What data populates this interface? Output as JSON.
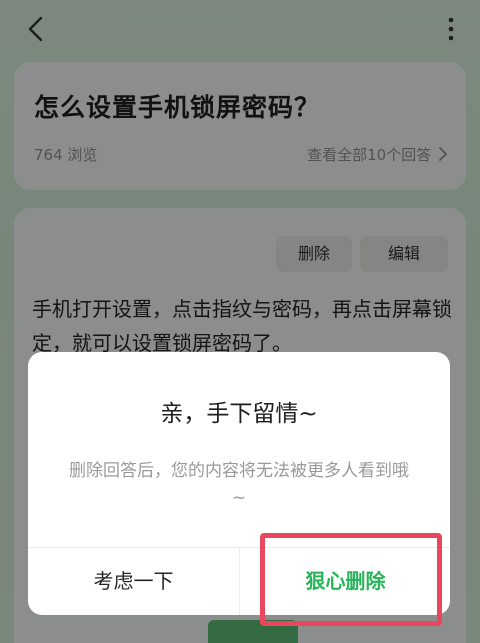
{
  "topbar": {
    "back_icon": "chevron-left-icon",
    "more_icon": "more-vertical-icon"
  },
  "question": {
    "title": "怎么设置手机锁屏密码？",
    "views": "764 浏览",
    "view_all": "查看全部10个回答",
    "view_all_icon": "chevron-right-icon"
  },
  "answer": {
    "delete_label": "删除",
    "edit_label": "编辑",
    "text": "手机打开设置，点击指纹与密码，再点击屏幕锁定，就可以设置锁屏密码了。"
  },
  "dialog": {
    "title": "亲，手下留情~",
    "message": "删除回答后，您的内容将无法被更多人看到哦 ~",
    "cancel_label": "考虑一下",
    "confirm_label": "狠心删除"
  },
  "colors": {
    "confirm": "#27b45a",
    "highlight": "#e8475e",
    "background": "#d3e8d6"
  }
}
